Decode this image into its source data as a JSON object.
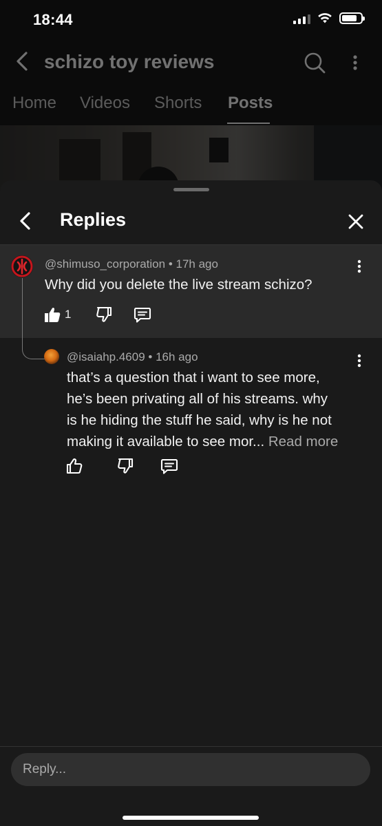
{
  "status_bar": {
    "time": "18:44"
  },
  "channel": {
    "title": "schizo toy reviews",
    "tabs": [
      {
        "label": "Home"
      },
      {
        "label": "Videos"
      },
      {
        "label": "Shorts"
      },
      {
        "label": "Posts",
        "active": true
      }
    ]
  },
  "sheet": {
    "title": "Replies",
    "comment": {
      "author": "@shimuso_corporation",
      "age": "17h ago",
      "text": "Why did you delete the live stream schizo?",
      "likes": "1"
    },
    "reply": {
      "author": "@isaiahp.4609",
      "age": "16h ago",
      "text_lines": [
        "that’s a question that i want to see more,",
        "he’s been privating all of his streams. why",
        "is he hiding the stuff he said, why is he not",
        "making it available to see mor..."
      ],
      "read_more": "Read more"
    },
    "reply_placeholder": "Reply..."
  },
  "icons": {
    "back": "chevron-left-icon",
    "search": "search-icon",
    "more": "more-vert-icon",
    "close": "close-icon",
    "like": "thumbs-up-icon",
    "dislike": "thumbs-down-icon",
    "reply": "comment-icon"
  },
  "colors": {
    "sheet_bg": "#1a1a1a",
    "highlight_comment_bg": "#2a2a2a",
    "secondary_text": "#aaaaaa",
    "input_bg": "#303030"
  }
}
